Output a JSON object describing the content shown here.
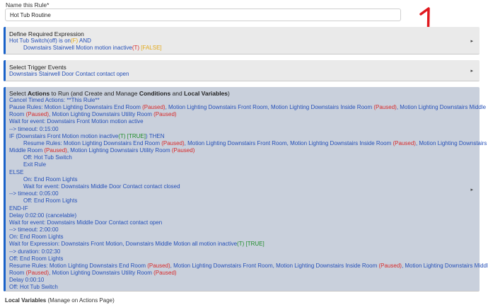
{
  "rule": {
    "name_label": "Name this Rule*",
    "name_value": "Hot Tub Routine"
  },
  "required_expression": {
    "title": "Define Required Expression",
    "line1_a": "Hot Tub Switch(off) is on",
    "line1_b": "(F)",
    "line1_c": "  AND",
    "line2_a": "Downstairs Stairwell Motion motion inactive",
    "line2_b": "(T)",
    "line2_c": " [FALSE]"
  },
  "trigger": {
    "title": "Select Trigger Events",
    "line1": "Downstairs Stairwell Door Contact contact open"
  },
  "actions": {
    "title_a": "Select ",
    "title_b": "Actions",
    "title_c": " to Run (and Create and Manage ",
    "title_d": "Conditions",
    "title_e": " and ",
    "title_f": "Local Variables",
    "title_g": ")",
    "l01": "Cancel Timed Actions: **This Rule**",
    "l02a": "Pause Rules: Motion Lighting Downstairs End Room ",
    "l02b": "(Paused)",
    "l02c": ", Motion Lighting Downstairs Front Room, Motion Lighting Downstairs Inside Room ",
    "l02d": "(Paused)",
    "l02e": ", Motion Lighting Downstairs Middle",
    "l03a": "Room ",
    "l03b": "(Paused)",
    "l03c": ", Motion Lighting Downstairs Utility Room ",
    "l03d": "(Paused)",
    "l04": "Wait for event: Downstairs Front Motion motion active",
    "l05": " --> timeout: 0:15:00",
    "l06a": "IF (Downstairs Front Motion motion inactive",
    "l06b": "(T)",
    "l06c": " [TRUE]",
    "l06d": ") THEN",
    "l07a": "Resume Rules: Motion Lighting Downstairs End Room ",
    "l07b": "(Paused)",
    "l07c": ", Motion Lighting Downstairs Front Room, Motion Lighting Downstairs Inside Room ",
    "l07d": "(Paused)",
    "l07e": ", Motion Lighting Downstairs",
    "l08a": "Middle Room ",
    "l08b": "(Paused)",
    "l08c": ", Motion Lighting Downstairs Utility Room ",
    "l08d": "(Paused)",
    "l09": "Off: Hot Tub Switch",
    "l10": "Exit Rule",
    "l11": "ELSE",
    "l12": "On: End Room Lights",
    "l13": "Wait for event: Downstairs Middle Door Contact contact closed",
    "l14": " --> timeout: 0:05:00",
    "l15": "Off: End Room Lights",
    "l16": "END-IF",
    "l17": "Delay 0:02:00 (cancelable)",
    "l18": "Wait for event: Downstairs Middle Door Contact contact open",
    "l19": " --> timeout: 2:00:00",
    "l20": "On: End Room Lights",
    "l21a": "Wait for Expression: Downstairs Front Motion, Downstairs Middle Motion all motion inactive",
    "l21b": "(T)",
    "l21c": " [TRUE]",
    "l22": " --> duration: 0:02:30",
    "l23": "Off: End Room Lights",
    "l24a": "Resume Rules: Motion Lighting Downstairs End Room ",
    "l24b": "(Paused)",
    "l24c": ", Motion Lighting Downstairs Front Room, Motion Lighting Downstairs Inside Room ",
    "l24d": "(Paused)",
    "l24e": ", Motion Lighting Downstairs Middle",
    "l25a": "Room ",
    "l25b": "(Paused)",
    "l25c": ", Motion Lighting Downstairs Utility Room ",
    "l25d": "(Paused)",
    "l26": "Delay 0:00:10",
    "l27": "Off: Hot Tub Switch"
  },
  "footer": {
    "a": "Local Variables",
    "b": " (Manage on Actions Page)"
  },
  "chevron": "▸",
  "colors": {
    "accent": "#1a62c9",
    "paused": "#d82a2a",
    "false": "#e2a91a",
    "true": "#1f8c2a",
    "annotation": "#e0181e"
  }
}
